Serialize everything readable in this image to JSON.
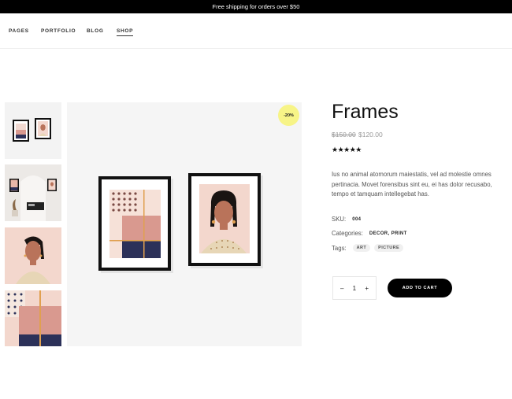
{
  "topbar": {
    "text": "Free shipping for orders over $50"
  },
  "nav": {
    "items": [
      "PAGES",
      "PORTFOLIO",
      "BLOG",
      "SHOP"
    ]
  },
  "product": {
    "badge": "-20%",
    "title": "Frames",
    "price_old": "$150.00",
    "price_new": "$120.00",
    "rating_stars": "★★★★★",
    "rating_value": 5,
    "description": "Ius no animal atomorum maiestatis, vel ad molestie omnes pertinacia. Movet forensibus sint eu, ei has dolor recusabo, tempo et tamquam intellegebat has.",
    "sku_label": "SKU:",
    "sku_value": "004",
    "categories_label": "Categories:",
    "categories": [
      "DECOR",
      "PRINT"
    ],
    "tags_label": "Tags:",
    "tags": [
      "ART",
      "PICTURE"
    ]
  },
  "cart": {
    "minus": "–",
    "quantity": "1",
    "plus": "+",
    "add_label": "ADD TO CART"
  },
  "colors": {
    "topbar_bg": "#000000",
    "badge_bg": "#f7f487",
    "button_bg": "#000000",
    "art_pink": "#d9998f",
    "art_navy": "#2c3159",
    "art_orange": "#e0a050",
    "skin": "#b9735a"
  }
}
